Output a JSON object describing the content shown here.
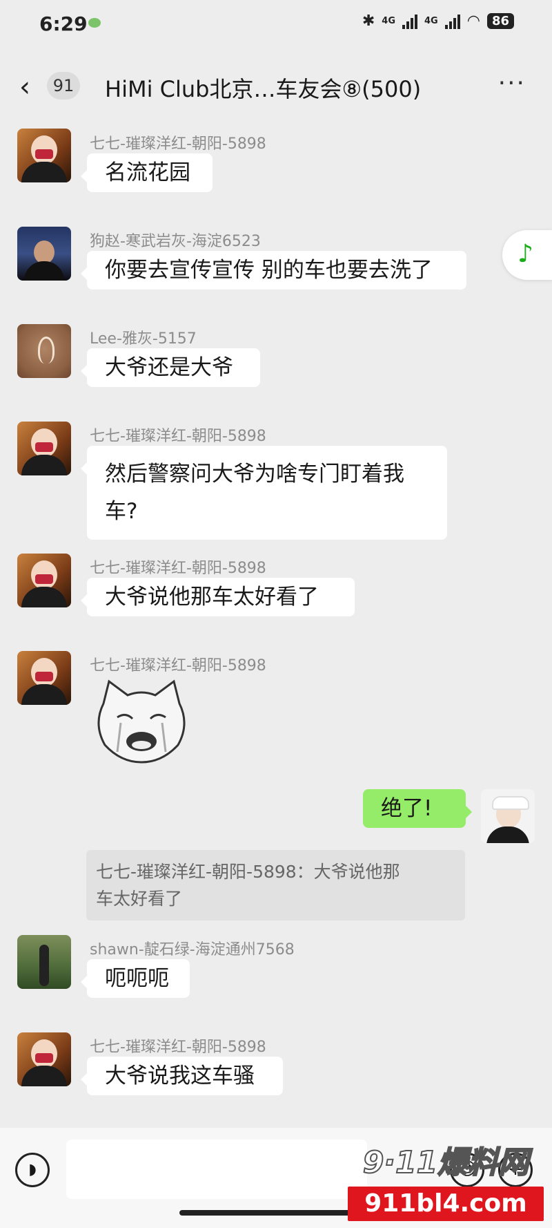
{
  "status_bar": {
    "time": "6:29",
    "network1": "4G",
    "network2": "4G",
    "battery": "86"
  },
  "header": {
    "unread_count": "91",
    "title": "HiMi Club北京…车友会⑧(500)"
  },
  "messages": [
    {
      "sender": "七七-璀璨洋红-朝阳-5898",
      "text": "名流花园"
    },
    {
      "sender": "狗赵-寒武岩灰-海淀6523",
      "text": "你要去宣传宣传 别的车也要去洗了"
    },
    {
      "sender": "Lee-雅灰-5157",
      "text": "大爷还是大爷"
    },
    {
      "sender": "七七-璀璨洋红-朝阳-5898",
      "text_line1": "然后警察问大爷为啥专门盯着我",
      "text_line2": "车?"
    },
    {
      "sender": "七七-璀璨洋红-朝阳-5898",
      "text": "大爷说他那车太好看了"
    },
    {
      "sender": "七七-璀璨洋红-朝阳-5898"
    },
    {
      "sender": "me",
      "text": "绝了!",
      "quote_line1": "七七-璀璨洋红-朝阳-5898：大爷说他那",
      "quote_line2": "车太好看了"
    },
    {
      "sender": "shawn-靛石绿-海淀通州7568",
      "text": "呃呃呃"
    },
    {
      "sender": "七七-璀璨洋红-朝阳-5898",
      "text": "大爷说我这车骚"
    }
  ],
  "music_icon": "music-note-icon",
  "input_bar": {
    "placeholder": ""
  },
  "watermark": {
    "top": "9·11爆料网",
    "bottom": "911bl4.com"
  },
  "colors": {
    "background": "#ededed",
    "my_bubble": "#95ec69",
    "other_bubble": "#ffffff",
    "watermark_red": "#e0161e"
  }
}
